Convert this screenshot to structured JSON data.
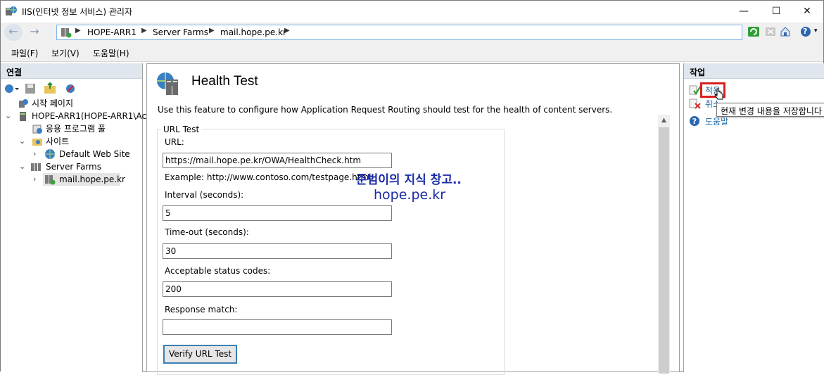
{
  "window": {
    "title": "IIS(인터넷 정보 서비스) 관리자",
    "minimize_glyph": "—",
    "maximize_glyph": "☐",
    "close_glyph": "✕"
  },
  "nav": {
    "back_glyph": "←",
    "forward_glyph": "→",
    "breadcrumb": [
      "HOPE-ARR1",
      "Server Farms",
      "mail.hope.pe.kr"
    ],
    "sep_glyph": "▶",
    "trailing_sep": "▶",
    "help_glyph": "?"
  },
  "menu": {
    "items": [
      "파일(F)",
      "보기(V)",
      "도움말(H)"
    ]
  },
  "connections": {
    "header": "연결",
    "tree": [
      {
        "label": "시작 페이지",
        "icon": "start-page-icon",
        "twisty": ""
      },
      {
        "label": "HOPE-ARR1(HOPE-ARR1\\Ac",
        "icon": "server-icon",
        "twisty": "⌄"
      },
      {
        "label": "응용 프로그램 풀",
        "icon": "app-pool-icon",
        "twisty": ""
      },
      {
        "label": "사이트",
        "icon": "sites-folder-icon",
        "twisty": "⌄"
      },
      {
        "label": "Default Web Site",
        "icon": "globe-icon",
        "twisty": "›"
      },
      {
        "label": "Server Farms",
        "icon": "server-farms-icon",
        "twisty": "⌄"
      },
      {
        "label": "mail.hope.pe.kr",
        "icon": "server-farm-icon",
        "twisty": "›"
      }
    ]
  },
  "main": {
    "title": "Health Test",
    "description": "Use this feature to configure how Application Request Routing should test for the health of content servers.",
    "group_title": "URL Test",
    "url_label": "URL:",
    "url_value": "https://mail.hope.pe.kr/OWA/HealthCheck.htm",
    "example": "Example: http://www.contoso.com/testpage.html",
    "interval_label": "Interval (seconds):",
    "interval_value": "5",
    "timeout_label": "Time-out (seconds):",
    "timeout_value": "30",
    "status_label": "Acceptable status codes:",
    "status_value": "200",
    "match_label": "Response match:",
    "match_value": "",
    "verify_button": "Verify URL Test",
    "scroll_up_glyph": "▲"
  },
  "watermark": {
    "line1": "준범이의 지식 창고..",
    "line2": "hope.pe.kr",
    "color": "#1a2aa8"
  },
  "actions": {
    "header": "작업",
    "apply": "적용",
    "cancel": "취소",
    "help": "도움말",
    "tooltip": "현재 변경 내용을 저장합니다"
  }
}
